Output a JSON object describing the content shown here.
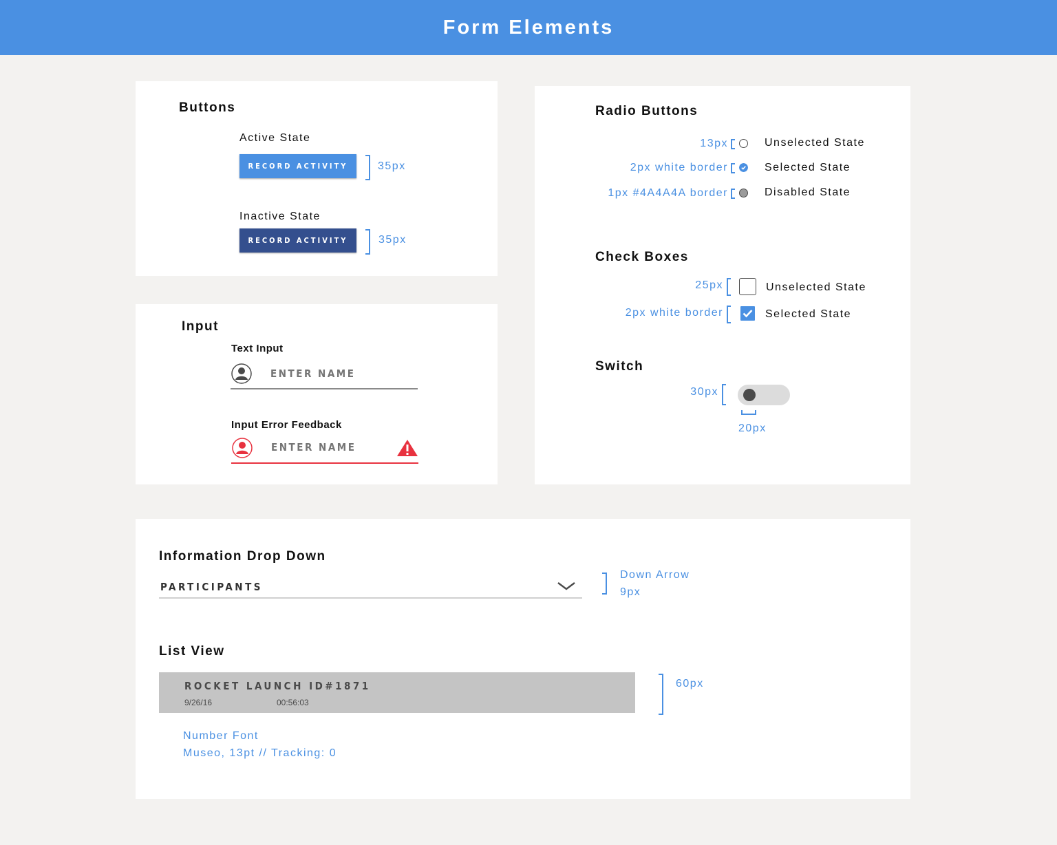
{
  "page_title": "Form Elements",
  "buttons": {
    "heading": "Buttons",
    "active": {
      "label": "Active State",
      "button_text": "RECORD ACTIVITY",
      "dimension": "35px",
      "color": "#4a90e2"
    },
    "inactive": {
      "label": "Inactive State",
      "button_text": "RECORD ACTIVITY",
      "dimension": "35px",
      "color": "#344f8e"
    }
  },
  "input": {
    "heading": "Input",
    "text_input": {
      "label": "Text Input",
      "placeholder": "ENTER NAME",
      "icon": "user-icon"
    },
    "error": {
      "label": "Input Error Feedback",
      "placeholder": "ENTER NAME",
      "icon": "user-icon",
      "warning_icon": "warning-icon",
      "color": "#e8323f"
    }
  },
  "radio": {
    "heading": "Radio Buttons",
    "items": [
      {
        "annotation": "13px",
        "label": "Unselected State"
      },
      {
        "annotation": "2px white border",
        "label": "Selected State"
      },
      {
        "annotation": "1px #4A4A4A border",
        "label": "Disabled State"
      }
    ]
  },
  "checkboxes": {
    "heading": "Check Boxes",
    "items": [
      {
        "annotation": "25px",
        "label": "Unselected State",
        "checked": false
      },
      {
        "annotation": "2px white border",
        "label": "Selected State",
        "checked": true
      }
    ]
  },
  "switch": {
    "heading": "Switch",
    "height_annotation": "30px",
    "width_annotation": "20px",
    "on": false
  },
  "dropdown": {
    "heading": "Information Drop Down",
    "selected": "PARTICIPANTS",
    "annotation_line1": "Down Arrow",
    "annotation_line2": "9px"
  },
  "list_view": {
    "heading": "List View",
    "item": {
      "title": "ROCKET LAUNCH ID#1871",
      "date": "9/26/16",
      "time": "00:56:03"
    },
    "height_annotation": "60px",
    "font_note_line1": "Number Font",
    "font_note_line2": "Museo, 13pt // Tracking: 0"
  }
}
